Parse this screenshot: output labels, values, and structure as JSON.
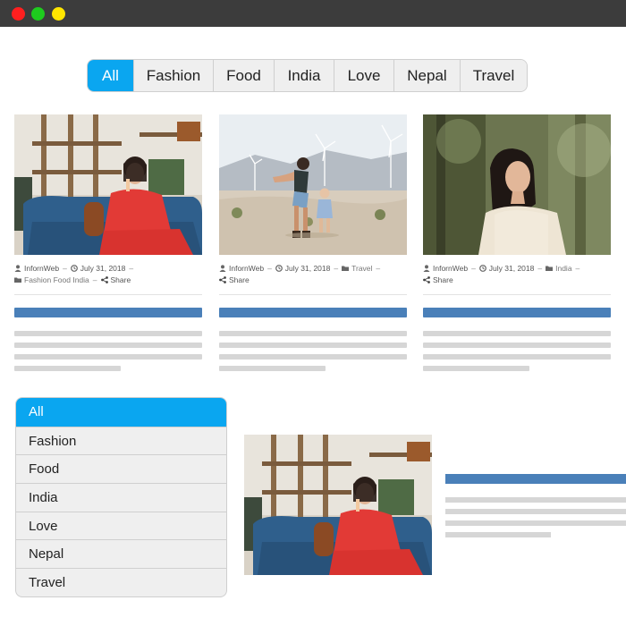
{
  "window": {
    "controls": [
      "close",
      "maximize",
      "minimize"
    ]
  },
  "filter_tabs": [
    "All",
    "Fashion",
    "Food",
    "India",
    "Love",
    "Nepal",
    "Travel"
  ],
  "active_filter": "All",
  "posts": [
    {
      "author": "InfornWeb",
      "date": "July 31, 2018",
      "categories": "Fashion Food India",
      "share": "Share",
      "image": "woman-on-blue-sofa"
    },
    {
      "author": "InfornWeb",
      "date": "July 31, 2018",
      "categories": "Travel",
      "share": "Share",
      "image": "mother-child-desert-windmills"
    },
    {
      "author": "InfornWeb",
      "date": "July 31, 2018",
      "categories": "India",
      "share": "Share",
      "image": "woman-in-forest"
    }
  ],
  "vertical_filter": [
    "All",
    "Fashion",
    "Food",
    "India",
    "Love",
    "Nepal",
    "Travel"
  ],
  "colors": {
    "accent": "#0aa6f0",
    "title_bar": "#4a80b9",
    "text_placeholder": "#d6d6d6"
  }
}
